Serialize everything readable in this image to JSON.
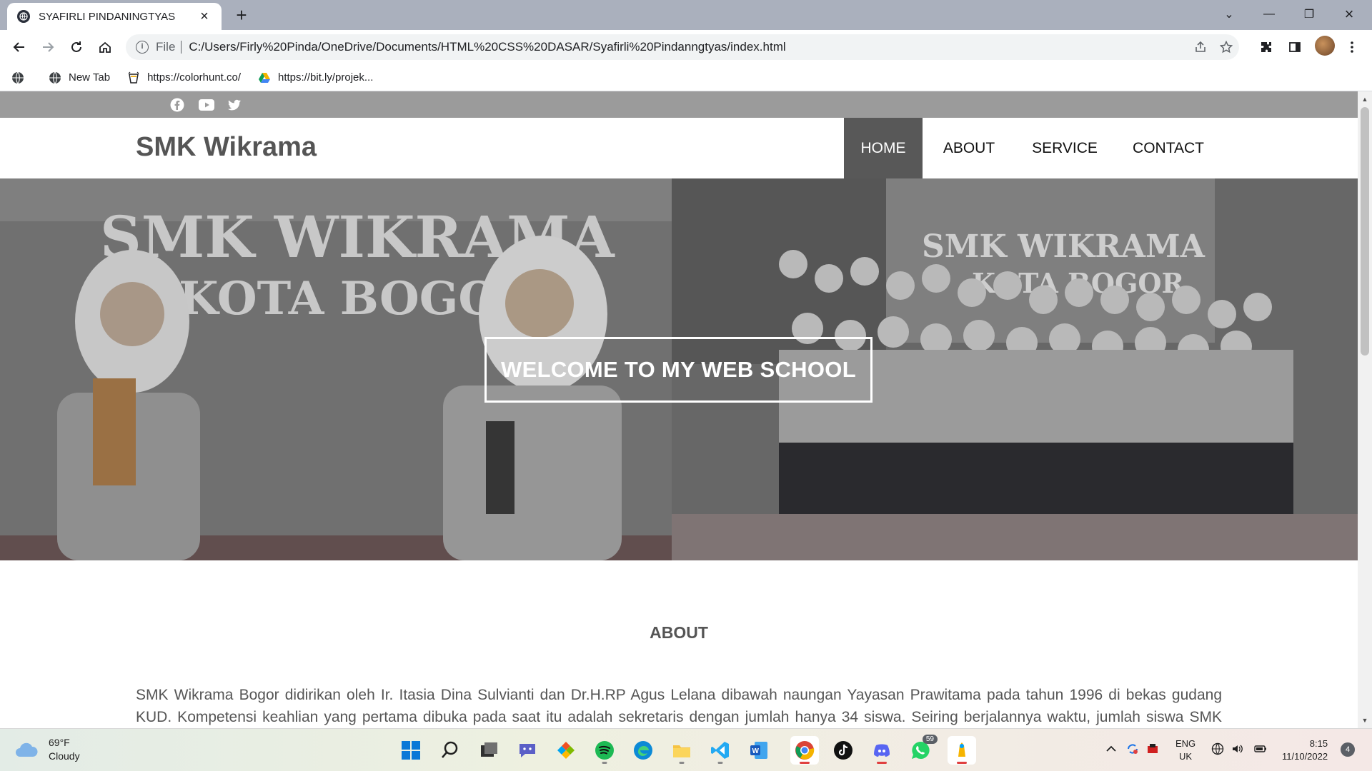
{
  "browser": {
    "tab_title": "SYAFIRLI PINDANINGTYAS",
    "url_scheme": "File",
    "url": "C:/Users/Firly%20Pinda/OneDrive/Documents/HTML%20CSS%20DASAR/Syafirli%20Pindanngtyas/index.html",
    "bookmarks": [
      {
        "label": "",
        "icon": "globe-icon"
      },
      {
        "label": "New Tab",
        "icon": "globe-icon"
      },
      {
        "label": "https://colorhunt.co/",
        "icon": "colorhunt-icon"
      },
      {
        "label": "https://bit.ly/projek...",
        "icon": "google-drive-icon"
      }
    ]
  },
  "site": {
    "social": [
      "facebook-icon",
      "youtube-icon",
      "twitter-icon"
    ],
    "brand": "SMK Wikrama",
    "menu": [
      "HOME",
      "ABOUT",
      "SERVICE",
      "CONTACT"
    ],
    "active_menu": "HOME",
    "hero": {
      "welcome": "WELCOME TO MY WEB SCHOOL",
      "sign_left_line1": "SMK WIKRAMA",
      "sign_left_line2": "KOTA BOGOR",
      "sign_right_line1": "SMK WIKRAMA",
      "sign_right_line2": "KOTA BOGOR"
    },
    "about": {
      "title": "ABOUT",
      "text": "SMK Wikrama Bogor didirikan oleh Ir. Itasia Dina Sulvianti dan Dr.H.RP Agus Lelana dibawah naungan Yayasan Prawitama pada tahun 1996 di bekas gudang KUD. Kompetensi keahlian yang pertama dibuka pada saat itu adalah sekretaris dengan jumlah hanya 34 siswa. Seiring berjalannya waktu, jumlah siswa SMK Wikrama"
    }
  },
  "taskbar": {
    "weather_temp": "69°F",
    "weather_desc": "Cloudy",
    "whatsapp_badge": "59",
    "lang_line1": "ENG",
    "lang_line2": "UK",
    "time": "8:15",
    "date": "11/10/2022",
    "notification_count": "4"
  }
}
